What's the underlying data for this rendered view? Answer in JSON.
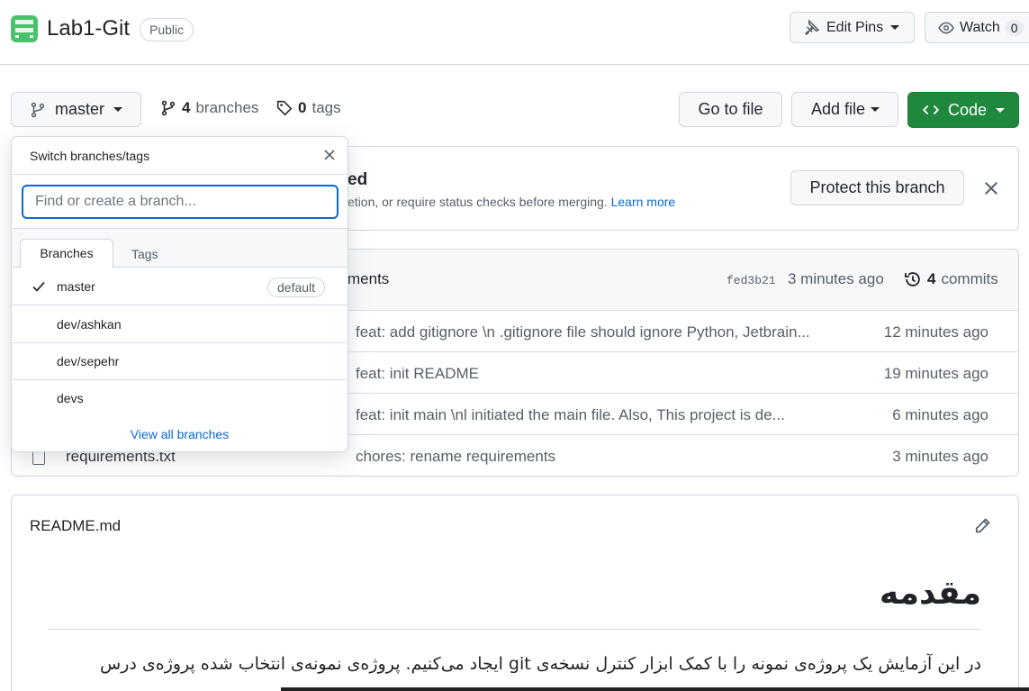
{
  "repo": {
    "name": "Lab1-Git",
    "visibility": "Public",
    "edit_pins_label": "Edit Pins",
    "watch_label": "Watch",
    "watch_count": "0"
  },
  "toolbar": {
    "branch_button": "master",
    "branches_count": "4",
    "branches_label": "branches",
    "tags_count": "0",
    "tags_label": "tags",
    "go_to_file": "Go to file",
    "add_file": "Add file",
    "code": "Code"
  },
  "protect": {
    "title_partial": "ed",
    "description_partial": "etion, or require status checks before merging.",
    "learn_more": "Learn more",
    "button": "Protect this branch"
  },
  "latest_commit": {
    "message_partial": "ments",
    "sha": "fed3b21",
    "time": "3 minutes ago",
    "commits_count": "4",
    "commits_label": "commits"
  },
  "files": [
    {
      "name": "",
      "commit": "feat: add gitignore \\n .gitignore file should ignore Python, Jetbrain...",
      "age": "12 minutes ago"
    },
    {
      "name": "",
      "commit": "feat: init README",
      "age": "19 minutes ago"
    },
    {
      "name": "",
      "commit": "feat: init main \\nl initiated the main file. Also, This project is de...",
      "age": "6 minutes ago"
    },
    {
      "name": "requirements.txt",
      "commit": "chores: rename requirements",
      "age": "3 minutes ago"
    }
  ],
  "readme": {
    "filename": "README.md",
    "heading": "مقدمه",
    "paragraph": "در این آزمایش یک پروژه‌ی نمونه را با کمک ابزار کنترل نسخه‌ی git ایجاد می‌کنیم. پروژه‌ی نمونه‌ی انتخاب شده پروژه‌ی درس"
  },
  "dropdown": {
    "title": "Switch branches/tags",
    "search_placeholder": "Find or create a branch...",
    "tab_branches": "Branches",
    "tab_tags": "Tags",
    "items": [
      {
        "label": "master",
        "badge": "default"
      },
      {
        "label": "dev/ashkan"
      },
      {
        "label": "dev/sepehr"
      },
      {
        "label": "devs"
      }
    ],
    "view_all": "View all branches"
  },
  "colors": {
    "accent_green": "#1f883d",
    "link_blue": "#0969da",
    "border": "#d0d7de"
  }
}
